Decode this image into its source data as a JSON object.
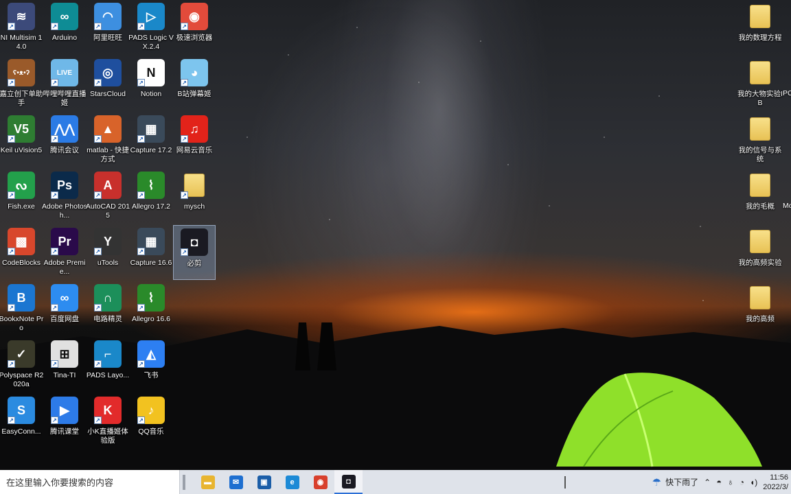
{
  "desktop": {
    "left_icons": [
      {
        "label": "NI Multisim 14.0",
        "icon": "multisim-icon",
        "glyph": "≋",
        "color": "#3c4a7a"
      },
      {
        "label": "Arduino",
        "icon": "arduino-icon",
        "glyph": "∞",
        "color": "#0e8c95"
      },
      {
        "label": "阿里旺旺",
        "icon": "aliwangwang-icon",
        "glyph": "◠",
        "color": "#3d8fe0"
      },
      {
        "label": "PADS Logic VX.2.4",
        "icon": "pads-logic-icon",
        "glyph": "▷",
        "color": "#1a88c9"
      },
      {
        "label": "极速浏览器",
        "icon": "browser-icon",
        "glyph": "◉",
        "color": "#e24b3b"
      },
      {
        "label": "嘉立创下单助手",
        "icon": "jlc-bear-icon",
        "glyph": "ʕ•ᴥ•ʔ",
        "color": "#9a5a2a"
      },
      {
        "label": "哔哩哔哩直播姬",
        "icon": "bilibili-live-icon",
        "glyph": "LIVE",
        "color": "#6fb8e8"
      },
      {
        "label": "StarsCloud",
        "icon": "starscloud-icon",
        "glyph": "◎",
        "color": "#1f4f9e"
      },
      {
        "label": "Notion",
        "icon": "notion-icon",
        "glyph": "N",
        "color": "#ffffff"
      },
      {
        "label": "B站弹幕姬",
        "icon": "bilibili-danmaku-icon",
        "glyph": "◕",
        "color": "#7dc5ee"
      },
      {
        "label": "Keil uVision5",
        "icon": "keil-icon",
        "glyph": "V5",
        "color": "#2e7d32"
      },
      {
        "label": "腾讯会议",
        "icon": "tencent-meeting-icon",
        "glyph": "⋀⋀",
        "color": "#2b7be5"
      },
      {
        "label": "matlab - 快捷方式",
        "icon": "matlab-icon",
        "glyph": "▲",
        "color": "#d8632a"
      },
      {
        "label": "Capture 17.2",
        "icon": "capture-icon",
        "glyph": "▦",
        "color": "#3a4a5a"
      },
      {
        "label": "网易云音乐",
        "icon": "netease-music-icon",
        "glyph": "♫",
        "color": "#e2231a"
      },
      {
        "label": "Fish.exe",
        "icon": "fish-icon",
        "glyph": "ᔓ",
        "color": "#23a04b"
      },
      {
        "label": "Adobe Photosh...",
        "icon": "photoshop-icon",
        "glyph": "Ps",
        "color": "#0b2a4a"
      },
      {
        "label": "AutoCAD 2015",
        "icon": "autocad-icon",
        "glyph": "A",
        "color": "#c8302c"
      },
      {
        "label": "Allegro 17.2",
        "icon": "allegro-icon",
        "glyph": "⌇",
        "color": "#2a8a2a"
      },
      {
        "label": "mysch",
        "icon": "folder-icon",
        "glyph": "",
        "color": "#f0cf6a"
      },
      {
        "label": "CodeBlocks",
        "icon": "codeblocks-icon",
        "glyph": "▩",
        "color": "#d8472c"
      },
      {
        "label": "Adobe Premie...",
        "icon": "premiere-icon",
        "glyph": "Pr",
        "color": "#2a0a4a"
      },
      {
        "label": "uTools",
        "icon": "utools-icon",
        "glyph": "Y",
        "color": "#333333"
      },
      {
        "label": "Capture 16.6",
        "icon": "capture-icon",
        "glyph": "▦",
        "color": "#3a4a5a"
      },
      {
        "label": "必剪",
        "icon": "bijian-icon",
        "glyph": "◘",
        "color": "#1a1a22"
      },
      {
        "label": "BookxNote Pro",
        "icon": "bookxnote-icon",
        "glyph": "B",
        "color": "#1b76d1"
      },
      {
        "label": "百度网盘",
        "icon": "baidu-netdisk-icon",
        "glyph": "∞",
        "color": "#2d8cf0"
      },
      {
        "label": "电路精灵",
        "icon": "circuit-wizard-icon",
        "glyph": "∩",
        "color": "#1c8f5a"
      },
      {
        "label": "Allegro 16.6",
        "icon": "allegro-icon",
        "glyph": "⌇",
        "color": "#2a8a2a"
      },
      {
        "label": "Polyspace R2020a",
        "icon": "polyspace-icon",
        "glyph": "✓",
        "color": "#3a3a2a"
      },
      {
        "label": "Tina-TI",
        "icon": "tina-ti-icon",
        "glyph": "⊞",
        "color": "#e0e0e0"
      },
      {
        "label": "PADS Layo...",
        "icon": "pads-layout-icon",
        "glyph": "⌐",
        "color": "#1a88c9"
      },
      {
        "label": "飞书",
        "icon": "feishu-icon",
        "glyph": "◭",
        "color": "#2d7ff2"
      },
      {
        "label": "EasyConn...",
        "icon": "easyconnect-icon",
        "glyph": "S",
        "color": "#2b8be0"
      },
      {
        "label": "腾讯课堂",
        "icon": "tencent-classroom-icon",
        "glyph": "▶",
        "color": "#2d7be8"
      },
      {
        "label": "小K直播姬体验版",
        "icon": "xiaok-live-icon",
        "glyph": "K",
        "color": "#e22b2b"
      },
      {
        "label": "QQ音乐",
        "icon": "qq-music-icon",
        "glyph": "♪",
        "color": "#f2c220"
      }
    ],
    "right_icons": [
      {
        "label": "我的数理方程"
      },
      {
        "label": "我的大物实验IB"
      },
      {
        "label": "我的信号与系统"
      },
      {
        "label": "我的毛概"
      },
      {
        "label": "我的高频实验"
      },
      {
        "label": "我的高频"
      }
    ],
    "partial_edge_labels": [
      "PC",
      "Mo"
    ]
  },
  "taskbar": {
    "search_placeholder": "在这里输入你要搜索的内容",
    "pinned": [
      {
        "name": "file-explorer-icon",
        "glyph": "▬",
        "color": "#e8b530"
      },
      {
        "name": "mail-icon",
        "glyph": "✉",
        "color": "#1e6fd0"
      },
      {
        "name": "store-icon",
        "glyph": "▣",
        "color": "#1b5ea8"
      },
      {
        "name": "edge-icon",
        "glyph": "e",
        "color": "#1c8ad6"
      },
      {
        "name": "chrome-icon",
        "glyph": "◉",
        "color": "#d8402c"
      },
      {
        "name": "bijian-icon",
        "glyph": "◘",
        "color": "#1a1a22"
      }
    ],
    "weather_text": "快下雨了",
    "clock_time": "11:56",
    "clock_date": "2022/3/"
  },
  "colors": {
    "taskbar_bg": "#dfe3ea",
    "accent": "#2b6fd6",
    "tent_green": "#7ed321"
  }
}
